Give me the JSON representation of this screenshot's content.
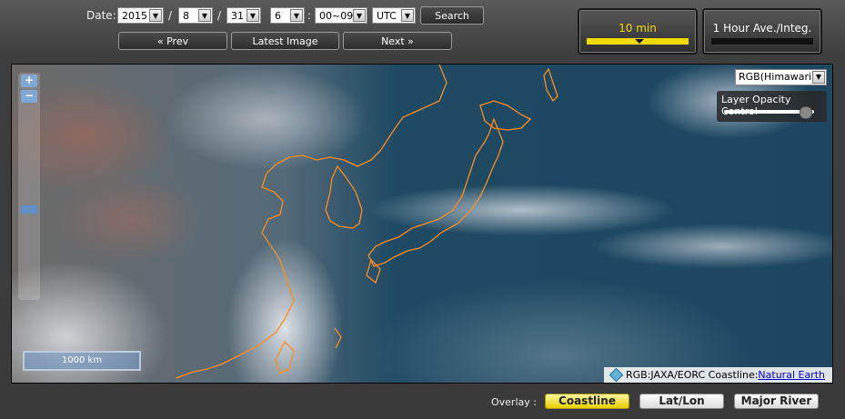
{
  "date_controls": {
    "label": "Date:",
    "year": "2015",
    "month": "8",
    "day": "31",
    "hour": "6",
    "minute": "00~09",
    "timezone": "UTC",
    "separator": "/",
    "search_label": "Search"
  },
  "navigation": {
    "prev_label": "« Prev",
    "latest_label": "Latest Image",
    "next_label": "Next »"
  },
  "modes": {
    "ten_min_label": "10 min",
    "hour_label": "1 Hour Ave./Integ.",
    "active": "10 min"
  },
  "map": {
    "zoom_in": "+",
    "zoom_out": "−",
    "layer_select": "RGB(Himawari)",
    "opacity_title": "Layer Opacity Control",
    "opacity_value": 0.85,
    "scale_label": "1000 km",
    "attribution_text": "RGB:JAXA/EORC Coastline:",
    "attribution_link": "Natural Earth"
  },
  "overlay": {
    "label": "Overlay :",
    "coastline": "Coastline",
    "latlon": "Lat/Lon",
    "river": "Major River",
    "active": "Coastline"
  },
  "colors": {
    "accent_yellow": "#f2dc00",
    "coastline": "#ff8c1a",
    "ocean": "#1f4a63"
  }
}
